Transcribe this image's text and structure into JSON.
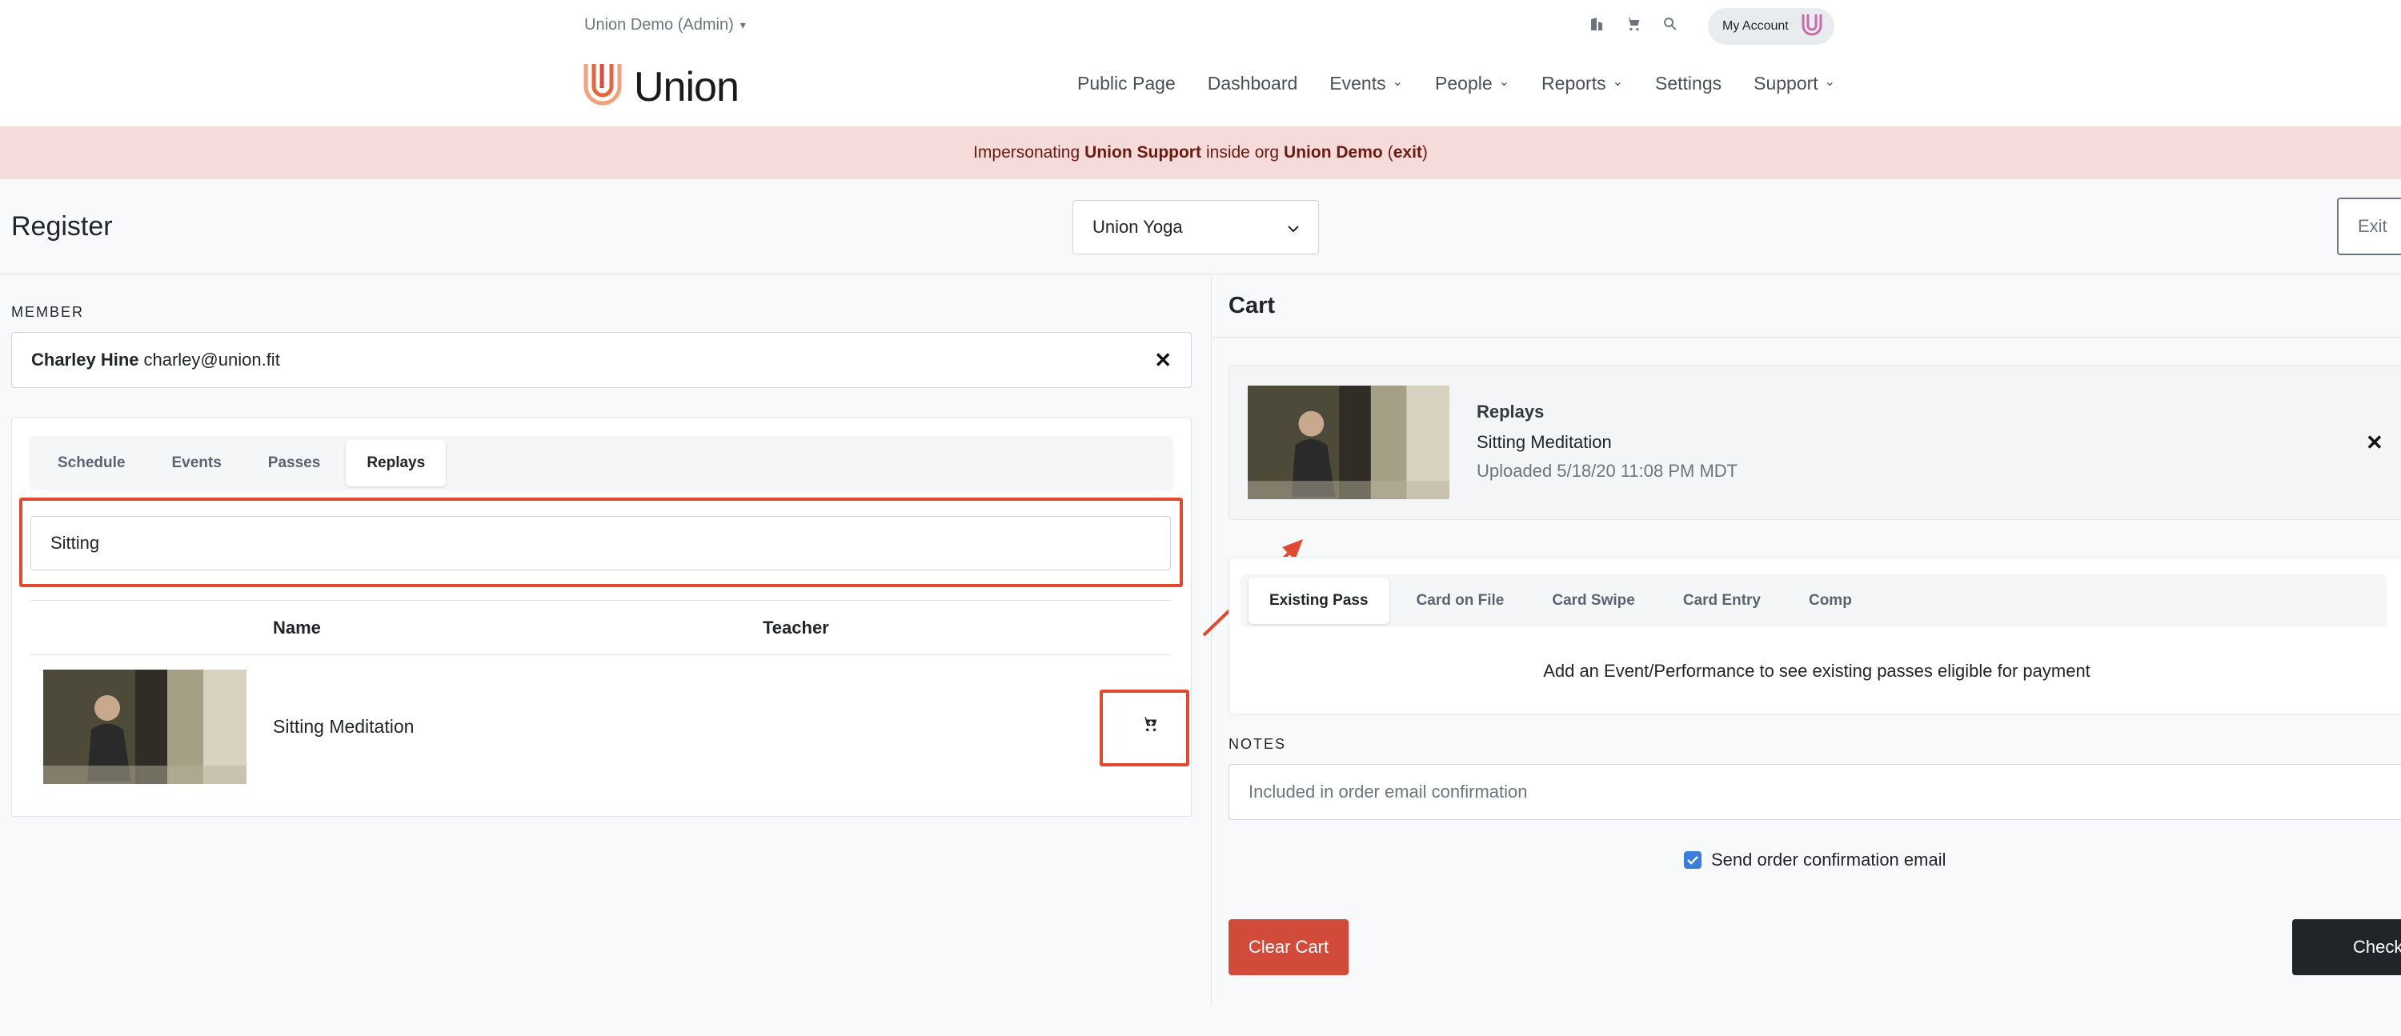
{
  "header": {
    "org_switch": "Union Demo (Admin)",
    "account_label": "My Account",
    "brand": "Union",
    "nav": [
      {
        "label": "Public Page"
      },
      {
        "label": "Dashboard"
      },
      {
        "label": "Events"
      },
      {
        "label": "People"
      },
      {
        "label": "Reports"
      },
      {
        "label": "Settings"
      },
      {
        "label": "Support"
      }
    ]
  },
  "impersonation": {
    "prefix": "Impersonating",
    "user": "Union Support",
    "mid": "inside org",
    "org": "Union Demo",
    "open_paren": "(",
    "exit": "exit",
    "close_paren": ")"
  },
  "page": {
    "title": "Register",
    "location": "Union Yoga",
    "exit_label": "Exit"
  },
  "member": {
    "label": "MEMBER",
    "name": "Charley Hine",
    "email": "charley@union.fit"
  },
  "catalog": {
    "tabs": [
      {
        "label": "Schedule"
      },
      {
        "label": "Events"
      },
      {
        "label": "Passes"
      },
      {
        "label": "Replays"
      }
    ],
    "search_value": "Sitting",
    "columns": {
      "name": "Name",
      "teacher": "Teacher"
    },
    "rows": [
      {
        "name": "Sitting Meditation",
        "teacher": ""
      }
    ]
  },
  "cart": {
    "title": "Cart",
    "item": {
      "type": "Replays",
      "name": "Sitting Meditation",
      "uploaded": "Uploaded 5/18/20 11:08 PM MDT"
    },
    "payment_tabs": [
      {
        "label": "Existing Pass"
      },
      {
        "label": "Card on File"
      },
      {
        "label": "Card Swipe"
      },
      {
        "label": "Card Entry"
      },
      {
        "label": "Comp"
      }
    ],
    "payment_message": "Add an Event/Performance to see existing passes eligible for payment",
    "notes_label": "NOTES",
    "notes_placeholder": "Included in order email confirmation",
    "send_confirmation_label": "Send order confirmation email",
    "send_confirmation_checked": true,
    "clear_label": "Clear Cart",
    "checkout_label": "Checkout"
  },
  "colors": {
    "accent_red": "#d14a3a",
    "highlight_red": "#e04a2f",
    "impersonation_bg": "#f5dbd9",
    "checkbox_blue": "#3b7ddd"
  },
  "icons": [
    "chevron-down-icon",
    "building-icon",
    "cart-icon",
    "search-icon",
    "union-logo-icon",
    "close-icon",
    "add-to-cart-icon",
    "check-icon",
    "arrow-annotation"
  ]
}
